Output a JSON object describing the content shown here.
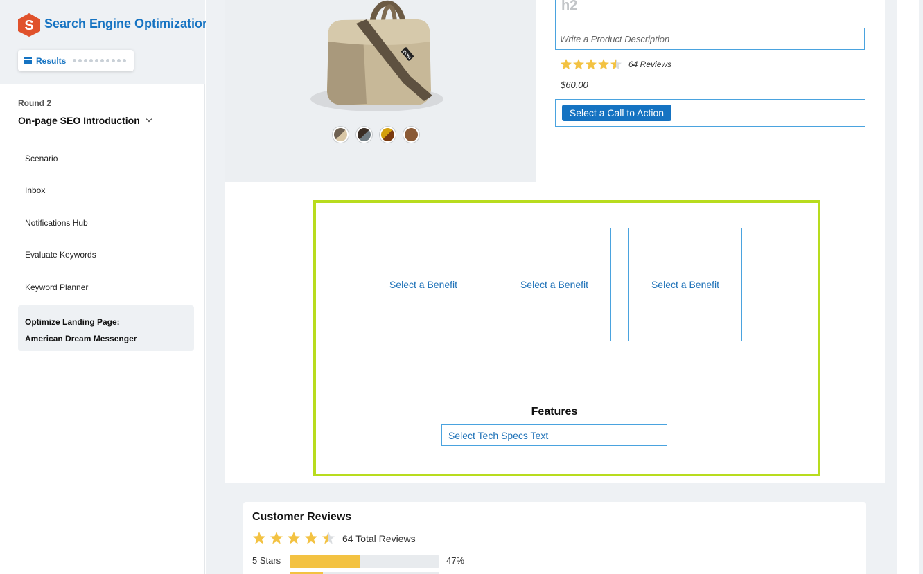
{
  "app": {
    "title": "Search Engine Optimization",
    "results_label": "Results"
  },
  "sidebar": {
    "round_label": "Round 2",
    "module_title": "On-page SEO Introduction",
    "items": [
      {
        "label": "Scenario"
      },
      {
        "label": "Inbox"
      },
      {
        "label": "Notifications Hub"
      },
      {
        "label": "Evaluate Keywords"
      },
      {
        "label": "Keyword Planner"
      }
    ],
    "active_item": {
      "line1": "Optimize Landing Page:",
      "line2": "American Dream Messenger"
    }
  },
  "product": {
    "heading_placeholder": "h2",
    "description_placeholder": "Write a Product Description",
    "rating": 4.5,
    "reviews_text": "64 Reviews",
    "price": "$60.00",
    "cta_label": "Select a Call to Action",
    "bag_brand": "BUNI",
    "swatches": [
      {
        "a": "#6e6152",
        "b": "#d9c7a6"
      },
      {
        "a": "#3a2d24",
        "b": "#6f7b82"
      },
      {
        "a": "#d49f0c",
        "b": "#7a3a10"
      },
      {
        "a": "#8a5a36",
        "b": "#8a5a36"
      }
    ]
  },
  "benefits": {
    "items": [
      {
        "label": "Select a Benefit"
      },
      {
        "label": "Select a Benefit"
      },
      {
        "label": "Select a Benefit"
      }
    ]
  },
  "features": {
    "title": "Features",
    "tech_specs_label": "Select Tech Specs Text"
  },
  "customer_reviews": {
    "title": "Customer Reviews",
    "rating": 4.5,
    "total_text": "64 Total Reviews",
    "rows": [
      {
        "label": "5 Stars",
        "percent": 47,
        "percent_text": "47%"
      },
      {
        "label": "",
        "percent": 22,
        "percent_text": ""
      }
    ]
  },
  "colors": {
    "accent": "#1573c2",
    "outline": "#4aa3df",
    "highlight_frame": "#b8dc1e",
    "star": "#f3c242",
    "logo": "#e0522c"
  }
}
